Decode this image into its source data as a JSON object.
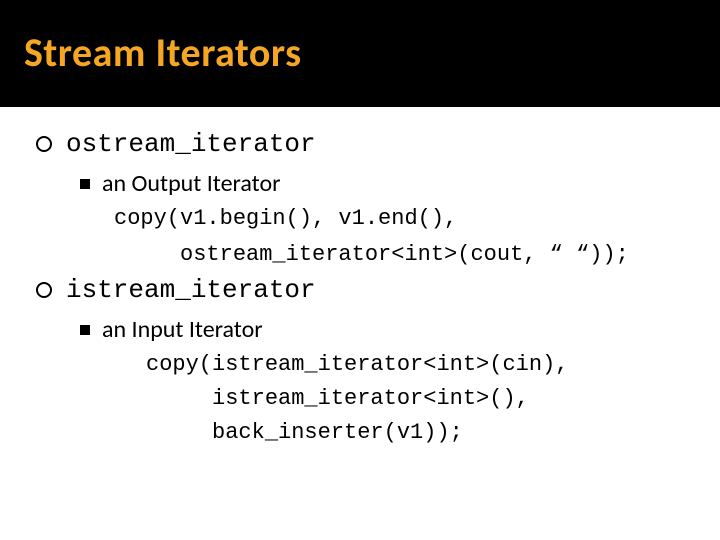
{
  "title": "Stream Iterators",
  "items": [
    {
      "heading": "ostream_iterator",
      "sub": "an Output Iterator",
      "code_lines": [
        "copy(v1.begin(), v1.end(),",
        "     ostream_iterator<int>(cout, “ “));"
      ]
    },
    {
      "heading": "istream_iterator",
      "sub": "an Input Iterator",
      "code_lines": [
        "copy(istream_iterator<int>(cin),",
        "     istream_iterator<int>(),",
        "     back_inserter(v1));"
      ]
    }
  ]
}
